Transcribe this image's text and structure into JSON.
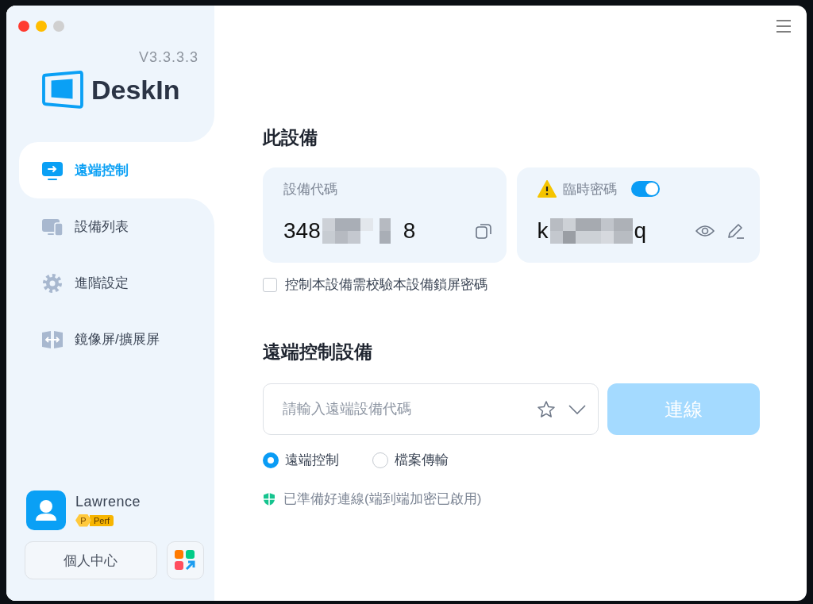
{
  "sidebar": {
    "version": "V3.3.3.3",
    "logo_text": "DeskIn",
    "items": [
      {
        "label": "遠端控制",
        "kind": "monitor",
        "selected": true
      },
      {
        "label": "設備列表",
        "kind": "devices",
        "selected": false
      },
      {
        "label": "進階設定",
        "kind": "settings",
        "selected": false
      },
      {
        "label": "鏡像屏/擴展屏",
        "kind": "mirror",
        "selected": false
      }
    ],
    "user": {
      "name": "Lawrence",
      "badge_letter": "P",
      "badge_text": "Perf"
    },
    "profile_button": "個人中心"
  },
  "this_device": {
    "title": "此設備",
    "device_code": {
      "label": "設備代碼",
      "start": "348",
      "end": "8"
    },
    "temp_password": {
      "label": "臨時密碼",
      "on": true,
      "start": "k",
      "end": "q"
    },
    "verify_lock_password": {
      "label": "控制本設備需校驗本設備鎖屏密碼",
      "checked": false
    }
  },
  "remote": {
    "title": "遠端控制設備",
    "placeholder": "請輸入遠端設備代碼",
    "connect_button": "連線",
    "connect_disabled": true,
    "modes": [
      {
        "label": "遠端控制",
        "selected": true
      },
      {
        "label": "檔案傳輸",
        "selected": false
      }
    ],
    "status": "已準備好連線(端到端加密已啟用)"
  }
}
